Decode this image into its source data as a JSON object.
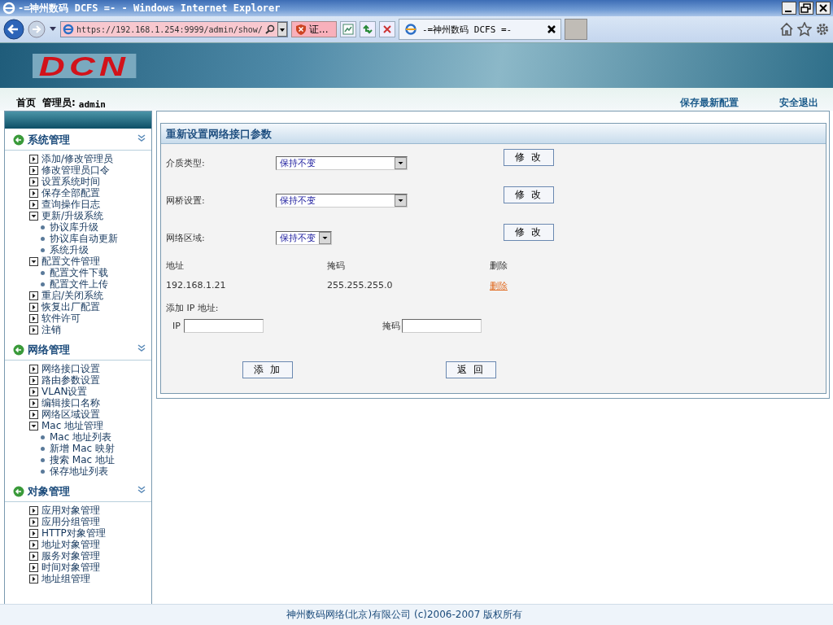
{
  "window": {
    "title": "-=神州数码 DCFS =- - Windows Internet Explorer"
  },
  "browser": {
    "address": "https://192.168.1.254:9999/admin/show/",
    "certificate": "证...",
    "tab": "-=神州数码 DCFS =-"
  },
  "header": {
    "logo": "DCN"
  },
  "topbar": {
    "home": "首页",
    "user_label": "管理员:",
    "user": "admin",
    "links": [
      "保存最新配置",
      "安全退出"
    ]
  },
  "sidebar": {
    "sections": [
      {
        "title": "系统管理",
        "expanded": true,
        "items": [
          {
            "label": "添加/修改管理员",
            "expanded": false
          },
          {
            "label": "修改管理员口令",
            "expanded": false
          },
          {
            "label": "设置系统时间",
            "expanded": false
          },
          {
            "label": "保存全部配置",
            "expanded": false
          },
          {
            "label": "查询操作日志",
            "expanded": false
          },
          {
            "label": "更新/升级系统",
            "expanded": true,
            "children": [
              "协议库升级",
              "协议库自动更新",
              "系统升级"
            ]
          },
          {
            "label": "配置文件管理",
            "expanded": true,
            "children": [
              "配置文件下载",
              "配置文件上传"
            ]
          },
          {
            "label": "重启/关闭系统",
            "expanded": false
          },
          {
            "label": "恢复出厂配置",
            "expanded": false
          },
          {
            "label": "软件许可",
            "expanded": false
          },
          {
            "label": "注销",
            "expanded": false
          }
        ]
      },
      {
        "title": "网络管理",
        "expanded": true,
        "items": [
          {
            "label": "网络接口设置",
            "expanded": false
          },
          {
            "label": "路由参数设置",
            "expanded": false
          },
          {
            "label": "VLAN设置",
            "expanded": false
          },
          {
            "label": "编辑接口名称",
            "expanded": false
          },
          {
            "label": "网络区域设置",
            "expanded": false
          },
          {
            "label": "Mac 地址管理",
            "expanded": true,
            "children": [
              "Mac 地址列表",
              "新增 Mac 映射",
              "搜索 Mac 地址",
              "保存地址列表"
            ]
          }
        ]
      },
      {
        "title": "对象管理",
        "expanded": true,
        "items": [
          {
            "label": "应用对象管理",
            "expanded": false
          },
          {
            "label": "应用分组管理",
            "expanded": false
          },
          {
            "label": "HTTP对象管理",
            "expanded": false
          },
          {
            "label": "地址对象管理",
            "expanded": false
          },
          {
            "label": "服务对象管理",
            "expanded": false
          },
          {
            "label": "时间对象管理",
            "expanded": false
          },
          {
            "label": "地址组管理",
            "expanded": false
          }
        ]
      }
    ]
  },
  "panel": {
    "title": "重新设置网络接口参数",
    "settings": [
      {
        "label": "介质类型:",
        "value": "保持不变",
        "button": "修 改"
      },
      {
        "label": "网桥设置:",
        "value": "保持不变",
        "button": "修 改"
      },
      {
        "label": "网络区域:",
        "value": "保持不变",
        "button": "修 改"
      }
    ],
    "table": {
      "columns": [
        "地址",
        "掩码",
        "删除"
      ],
      "rows": [
        {
          "address": "192.168.1.21",
          "mask": "255.255.255.0",
          "action": "删除"
        }
      ]
    },
    "add_label": "添加 IP 地址:",
    "fields": [
      {
        "label": "IP"
      },
      {
        "label": "掩码"
      }
    ],
    "buttons": [
      "添 加",
      "返 回"
    ]
  },
  "footer": "神州数码网络(北京)有限公司 (c)2006-2007 版权所有"
}
